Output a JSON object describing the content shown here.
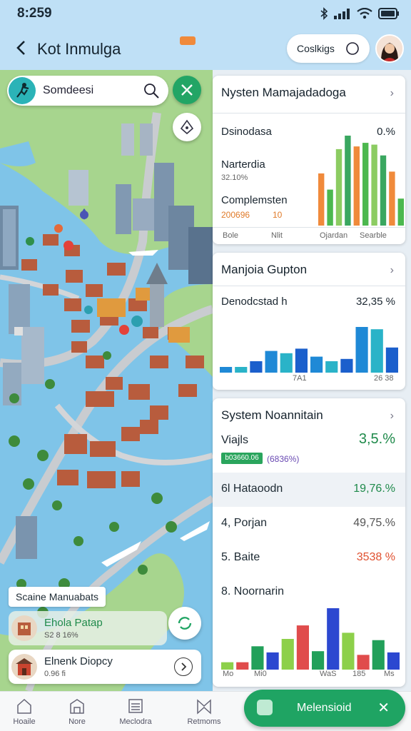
{
  "status": {
    "time": "8:259"
  },
  "header": {
    "title": "Kot Inmulga",
    "chip_label": "Coslkigs"
  },
  "map": {
    "search_text": "Somdeesi",
    "tag": "Scaine Manuabats",
    "place1": {
      "name": "Ehola Patap",
      "sub": "S2 8 16%"
    },
    "place2": {
      "name": "Elnenk Diopcy",
      "sub": "0.96 fi"
    }
  },
  "card1": {
    "title": "Nysten Mamajadadoga",
    "row1_label": "Dsinodasa",
    "row1_value": "0.%",
    "row2_label": "Narterdia",
    "row2_value": "32.10%",
    "row3_label": "Complemsten",
    "row3_value_a": "200696",
    "row3_value_b": "10",
    "axis": [
      "Bole",
      "Nlit",
      "Ojardan",
      "Searble"
    ]
  },
  "card2": {
    "title": "Manjoia Gupton",
    "label": "Denodcstad h",
    "value": "32,35 %",
    "axis": [
      "7A1",
      "26 38"
    ]
  },
  "card3": {
    "title": "System Noannitain",
    "metric_label": "Viajls",
    "metric_value": "3,5.%",
    "pill_green": "b03660.06",
    "pill_text": "(6836%)",
    "rows": [
      {
        "label": "6l Hataoodn",
        "value": "19,76.%"
      },
      {
        "label": "4, Porjan",
        "value": "49,75.%"
      },
      {
        "label": "5. Baite",
        "value": "3538 %"
      },
      {
        "label": "8. Noornarin",
        "value": ""
      }
    ],
    "axis": [
      "Mo",
      "Mi0",
      "WaS",
      "185",
      "Ms"
    ]
  },
  "chart_data": [
    {
      "type": "bar",
      "title": "Nysten Mamajadadoga",
      "categories": [
        "Bole",
        "Nlit",
        "Ojardan",
        "Searble"
      ],
      "series": [
        {
          "values": [
            58,
            40,
            85,
            100,
            88,
            92,
            90,
            78,
            60,
            30
          ]
        }
      ],
      "colors": [
        "#f08a3b",
        "#4cb84f",
        "#8ccc62",
        "#3aa760"
      ],
      "ylim": [
        0,
        100
      ]
    },
    {
      "type": "bar",
      "title": "Manjoia Gupton",
      "categories": [
        "7A1",
        "26 38"
      ],
      "series": [
        {
          "values": [
            10,
            10,
            20,
            38,
            34,
            42,
            28,
            20,
            24,
            80,
            76,
            44
          ]
        }
      ],
      "colors": [
        "#1f89d6",
        "#2ab3c8",
        "#1b5fcc"
      ],
      "ylim": [
        0,
        100
      ]
    },
    {
      "type": "bar",
      "title": "8. Noornarin",
      "categories": [
        "Mo",
        "Mi0",
        "WaS",
        "185",
        "Ms"
      ],
      "series": [
        {
          "values": [
            12,
            12,
            38,
            28,
            50,
            72,
            30,
            100,
            60,
            24,
            48,
            28
          ]
        }
      ],
      "colors": [
        "#8dd04a",
        "#e04c4c",
        "#22a05a",
        "#2c48d0"
      ],
      "ylim": [
        0,
        100
      ]
    }
  ],
  "nav": [
    "Hoaile",
    "Nore",
    "Meclodra",
    "Retmoms"
  ],
  "primary_button": "Melensioid"
}
